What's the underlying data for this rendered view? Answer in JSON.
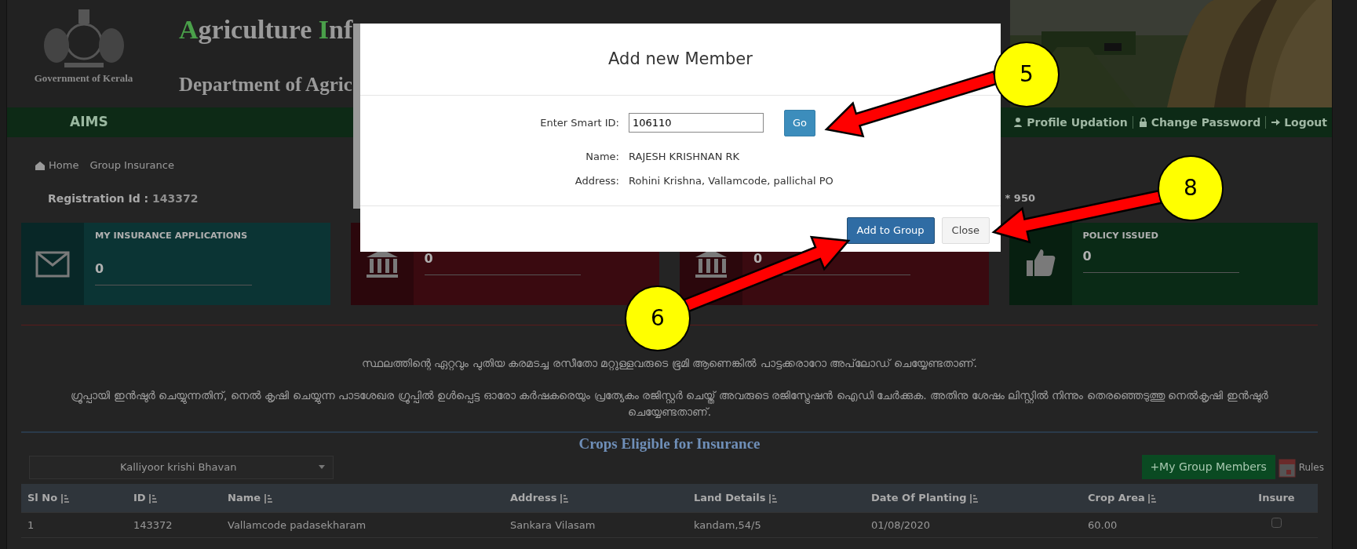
{
  "header": {
    "emblem_caption": "Government of Kerala",
    "title": "Agriculture Inf",
    "subtitle": "Department of Agric"
  },
  "nav": {
    "brand": "AIMS",
    "links": [
      {
        "label": "Profile Updation"
      },
      {
        "label": "Change Password"
      },
      {
        "label": "Logout"
      }
    ]
  },
  "breadcrumb": [
    {
      "label": "Home"
    },
    {
      "label": "Group Insurance"
    }
  ],
  "registration": {
    "label": "Registration Id :",
    "value": "143372"
  },
  "side_note": "* 950",
  "stat_cards": [
    {
      "title": "MY INSURANCE APPLICATIONS",
      "value": "0",
      "kind": "mail",
      "color": "#0b3434"
    },
    {
      "value": "0",
      "kind": "bank",
      "color": "#3a0a10"
    },
    {
      "value": "0",
      "kind": "bank",
      "color": "#3a0a10"
    },
    {
      "title": "POLICY ISSUED",
      "value": "0",
      "kind": "approval",
      "color": "#0a2a16"
    }
  ],
  "notices": [
    "സ്ഥലത്തിന്റെ ഏറ്റവും പുതിയ കരമടച്ച രസീതോ മറ്റുള്ളവരുടെ ഭൂമി ആണെങ്കിൽ പാട്ടക്കരാറോ അപ്‌ലോഡ് ചെയ്യേണ്ടതാണ്.",
    "ഗ്രൂപ്പായി ഇൻഷുർ ചെയ്യുന്നതിന്, നെൽ കൃഷി ചെയ്യുന്ന പാടശേഖര ഗ്രൂപ്പിൽ ഉൾപ്പെട്ട ഓരോ കർഷകരെയും പ്രത്യേകം രജിസ്റ്റർ ചെയ്ത് അവരുടെ രജിസ്ട്രേഷൻ ഐഡി ചേർക്കുക. അതിനു ശേഷം ലിസ്റ്റിൽ നിന്നും തെരഞ്ഞെടുത്തു നെൽകൃഷി ഇൻഷുർ ചെയ്യേണ്ടതാണ്."
  ],
  "crops": {
    "heading": "Crops Eligible for Insurance",
    "office_select": "Kalliyoor krishi Bhavan",
    "group_button": "+My Group Members",
    "rules_label": "Rules",
    "table": {
      "columns": [
        {
          "label": "Sl No",
          "sortable": true
        },
        {
          "label": "ID",
          "sortable": true
        },
        {
          "label": "Name",
          "sortable": true
        },
        {
          "label": "Address",
          "sortable": true
        },
        {
          "label": "Land Details",
          "sortable": true
        },
        {
          "label": "Date Of Planting",
          "sortable": true
        },
        {
          "label": "Crop Area",
          "sortable": true
        },
        {
          "label": "Insure",
          "sortable": false
        }
      ],
      "rows": [
        {
          "cells": [
            "1",
            "143372",
            "Vallamcode padasekharam",
            "Sankara Vilasam",
            "kandam,54/5",
            "01/08/2020",
            "60.00"
          ],
          "checked": false
        }
      ]
    }
  },
  "modal": {
    "title": "Add new Member",
    "fields": [
      {
        "kind": "input",
        "label": "Enter Smart ID:",
        "value": "106110"
      },
      {
        "kind": "text",
        "label": "Name:",
        "value": "RAJESH KRISHNAN RK"
      },
      {
        "kind": "text",
        "label": "Address:",
        "value": "Rohini Krishna, Vallamcode, pallichal PO"
      }
    ],
    "go_button": "Go",
    "buttons": [
      {
        "label": "Add to Group",
        "kind": "primary"
      },
      {
        "label": "Close",
        "kind": "default"
      }
    ]
  },
  "annotations": [
    {
      "label": "5"
    },
    {
      "label": "6"
    },
    {
      "label": "8"
    }
  ]
}
